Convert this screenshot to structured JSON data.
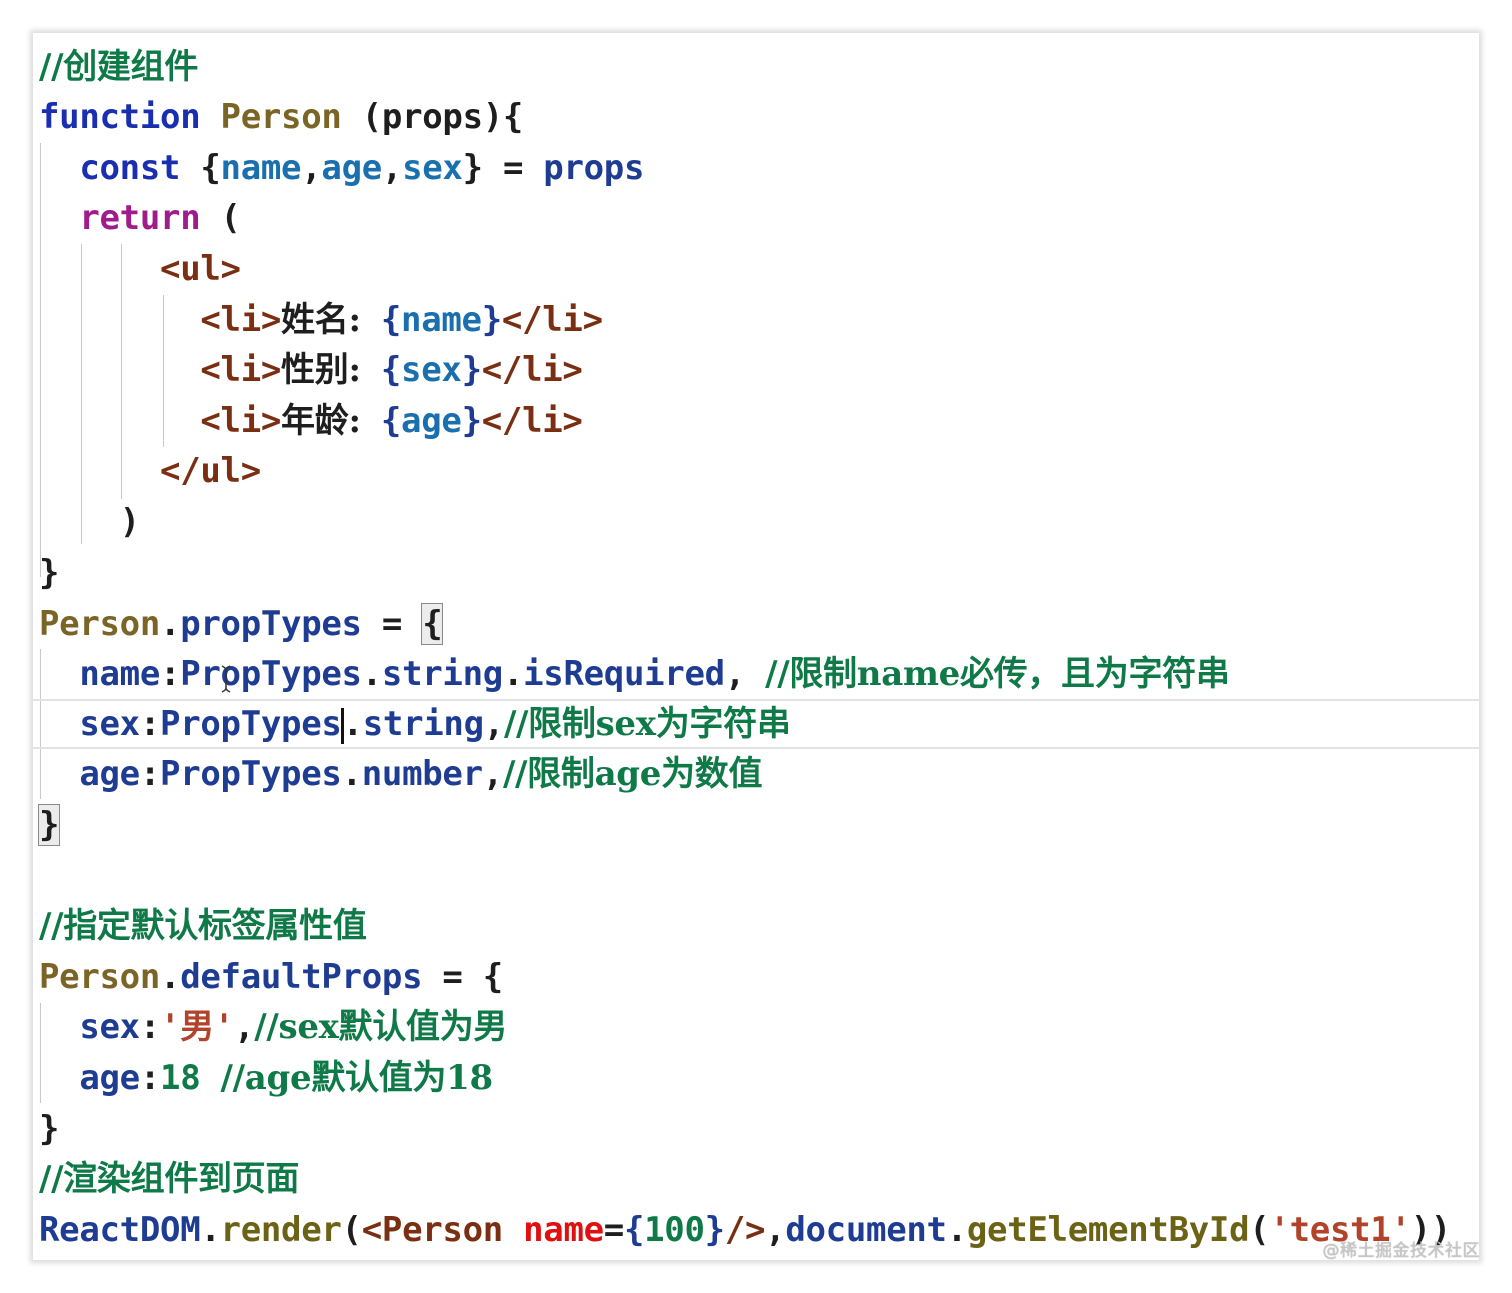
{
  "editor": {
    "lines": [
      {
        "id": "l1",
        "tokens": [
          {
            "t": "//创建组件",
            "c": "comment"
          }
        ]
      },
      {
        "id": "l2",
        "tokens": [
          {
            "t": "function",
            "c": "keyword"
          },
          {
            "t": " ",
            "c": "plain"
          },
          {
            "t": "Person",
            "c": "func"
          },
          {
            "t": " (props){",
            "c": "plain"
          }
        ]
      },
      {
        "id": "l3",
        "tokens": [
          {
            "t": "  ",
            "c": "plain"
          },
          {
            "t": "const",
            "c": "keyword"
          },
          {
            "t": " {",
            "c": "plain"
          },
          {
            "t": "name",
            "c": "var"
          },
          {
            "t": ",",
            "c": "plain"
          },
          {
            "t": "age",
            "c": "var"
          },
          {
            "t": ",",
            "c": "plain"
          },
          {
            "t": "sex",
            "c": "var"
          },
          {
            "t": "} = ",
            "c": "plain"
          },
          {
            "t": "props",
            "c": "obj"
          }
        ]
      },
      {
        "id": "l4",
        "tokens": [
          {
            "t": "  ",
            "c": "plain"
          },
          {
            "t": "return",
            "c": "return"
          },
          {
            "t": " (",
            "c": "plain"
          }
        ]
      },
      {
        "id": "l5",
        "tokens": [
          {
            "t": "      ",
            "c": "plain"
          },
          {
            "t": "<ul>",
            "c": "tag"
          }
        ]
      },
      {
        "id": "l6",
        "tokens": [
          {
            "t": "        ",
            "c": "plain"
          },
          {
            "t": "<li>",
            "c": "tag"
          },
          {
            "t": "姓名:",
            "c": "cn"
          },
          {
            "t": " ",
            "c": "plain"
          },
          {
            "t": "{",
            "c": "obj"
          },
          {
            "t": "name",
            "c": "var"
          },
          {
            "t": "}",
            "c": "obj"
          },
          {
            "t": "</li>",
            "c": "tag"
          }
        ]
      },
      {
        "id": "l7",
        "tokens": [
          {
            "t": "        ",
            "c": "plain"
          },
          {
            "t": "<li>",
            "c": "tag"
          },
          {
            "t": "性别:",
            "c": "cn"
          },
          {
            "t": " ",
            "c": "plain"
          },
          {
            "t": "{",
            "c": "obj"
          },
          {
            "t": "sex",
            "c": "var"
          },
          {
            "t": "}",
            "c": "obj"
          },
          {
            "t": "</li>",
            "c": "tag"
          }
        ]
      },
      {
        "id": "l8",
        "tokens": [
          {
            "t": "        ",
            "c": "plain"
          },
          {
            "t": "<li>",
            "c": "tag"
          },
          {
            "t": "年龄:",
            "c": "cn"
          },
          {
            "t": " ",
            "c": "plain"
          },
          {
            "t": "{",
            "c": "obj"
          },
          {
            "t": "age",
            "c": "var"
          },
          {
            "t": "}",
            "c": "obj"
          },
          {
            "t": "</li>",
            "c": "tag"
          }
        ]
      },
      {
        "id": "l9",
        "tokens": [
          {
            "t": "      ",
            "c": "plain"
          },
          {
            "t": "</ul>",
            "c": "tag"
          }
        ]
      },
      {
        "id": "l10",
        "tokens": [
          {
            "t": "    )",
            "c": "plain"
          }
        ]
      },
      {
        "id": "l11",
        "tokens": [
          {
            "t": "}",
            "c": "plain"
          }
        ]
      },
      {
        "id": "l12",
        "tokens": [
          {
            "t": "Person",
            "c": "func"
          },
          {
            "t": ".",
            "c": "plain"
          },
          {
            "t": "propTypes",
            "c": "prop"
          },
          {
            "t": " = ",
            "c": "plain"
          },
          {
            "t": "{",
            "c": "plain",
            "brace": true
          }
        ]
      },
      {
        "id": "l13",
        "tokens": [
          {
            "t": "  ",
            "c": "plain"
          },
          {
            "t": "name",
            "c": "prop"
          },
          {
            "t": ":",
            "c": "plain"
          },
          {
            "t": "PropTypes",
            "c": "prop"
          },
          {
            "t": ".",
            "c": "plain"
          },
          {
            "t": "string",
            "c": "prop"
          },
          {
            "t": ".",
            "c": "plain"
          },
          {
            "t": "isRequired",
            "c": "prop"
          },
          {
            "t": ", ",
            "c": "plain"
          },
          {
            "t": "//限制name必传，且为字符串",
            "c": "comment"
          }
        ]
      },
      {
        "id": "l14",
        "current": true,
        "tokens": [
          {
            "t": "  ",
            "c": "plain"
          },
          {
            "t": "sex",
            "c": "prop"
          },
          {
            "t": ":",
            "c": "plain"
          },
          {
            "t": "PropTypes",
            "c": "prop",
            "caret_after": true
          },
          {
            "t": ".",
            "c": "plain"
          },
          {
            "t": "string",
            "c": "prop"
          },
          {
            "t": ",",
            "c": "plain"
          },
          {
            "t": "//限制sex为字符串",
            "c": "comment"
          }
        ]
      },
      {
        "id": "l15",
        "tokens": [
          {
            "t": "  ",
            "c": "plain"
          },
          {
            "t": "age",
            "c": "prop"
          },
          {
            "t": ":",
            "c": "plain"
          },
          {
            "t": "PropTypes",
            "c": "prop"
          },
          {
            "t": ".",
            "c": "plain"
          },
          {
            "t": "number",
            "c": "prop"
          },
          {
            "t": ",",
            "c": "plain"
          },
          {
            "t": "//限制age为数值",
            "c": "comment"
          }
        ]
      },
      {
        "id": "l16",
        "tokens": [
          {
            "t": "}",
            "c": "plain",
            "brace": true
          }
        ]
      },
      {
        "id": "l17",
        "tokens": []
      },
      {
        "id": "l18",
        "tokens": [
          {
            "t": "//指定默认标签属性值",
            "c": "comment"
          }
        ]
      },
      {
        "id": "l19",
        "tokens": [
          {
            "t": "Person",
            "c": "func"
          },
          {
            "t": ".",
            "c": "plain"
          },
          {
            "t": "defaultProps",
            "c": "prop"
          },
          {
            "t": " = {",
            "c": "plain"
          }
        ]
      },
      {
        "id": "l20",
        "tokens": [
          {
            "t": "  ",
            "c": "plain"
          },
          {
            "t": "sex",
            "c": "prop"
          },
          {
            "t": ":",
            "c": "plain"
          },
          {
            "t": "'男'",
            "c": "string"
          },
          {
            "t": ",",
            "c": "plain"
          },
          {
            "t": "//sex默认值为男",
            "c": "comment"
          }
        ]
      },
      {
        "id": "l21",
        "tokens": [
          {
            "t": "  ",
            "c": "plain"
          },
          {
            "t": "age",
            "c": "prop"
          },
          {
            "t": ":",
            "c": "plain"
          },
          {
            "t": "18",
            "c": "num"
          },
          {
            "t": " ",
            "c": "plain"
          },
          {
            "t": "//age默认值为18",
            "c": "comment"
          }
        ]
      },
      {
        "id": "l22",
        "tokens": [
          {
            "t": "}",
            "c": "plain"
          }
        ]
      },
      {
        "id": "l23",
        "tokens": [
          {
            "t": "//渲染组件到页面",
            "c": "comment"
          }
        ]
      },
      {
        "id": "l24",
        "tokens": [
          {
            "t": "ReactDOM",
            "c": "obj"
          },
          {
            "t": ".",
            "c": "plain"
          },
          {
            "t": "render",
            "c": "method"
          },
          {
            "t": "(",
            "c": "plain"
          },
          {
            "t": "<Person",
            "c": "tag"
          },
          {
            "t": " ",
            "c": "plain"
          },
          {
            "t": "name",
            "c": "attr"
          },
          {
            "t": "=",
            "c": "plain"
          },
          {
            "t": "{",
            "c": "obj"
          },
          {
            "t": "100",
            "c": "num"
          },
          {
            "t": "}",
            "c": "obj"
          },
          {
            "t": "/>",
            "c": "tag"
          },
          {
            "t": ",",
            "c": "plain"
          },
          {
            "t": "document",
            "c": "obj"
          },
          {
            "t": ".",
            "c": "plain"
          },
          {
            "t": "getElementById",
            "c": "method"
          },
          {
            "t": "(",
            "c": "plain"
          },
          {
            "t": "'test1'",
            "c": "string"
          },
          {
            "t": "))",
            "c": "plain"
          }
        ]
      }
    ]
  },
  "watermark": "@稀土掘金技术社区",
  "colors": {
    "comment": "#0f7a48",
    "keyword": "#1a2fb0",
    "return": "#a01c8c",
    "func": "#7b6526",
    "prop": "#1f3c93",
    "var": "#1a6fae",
    "tag": "#7a2e12",
    "string": "#b0432a",
    "attr": "#e01010"
  }
}
